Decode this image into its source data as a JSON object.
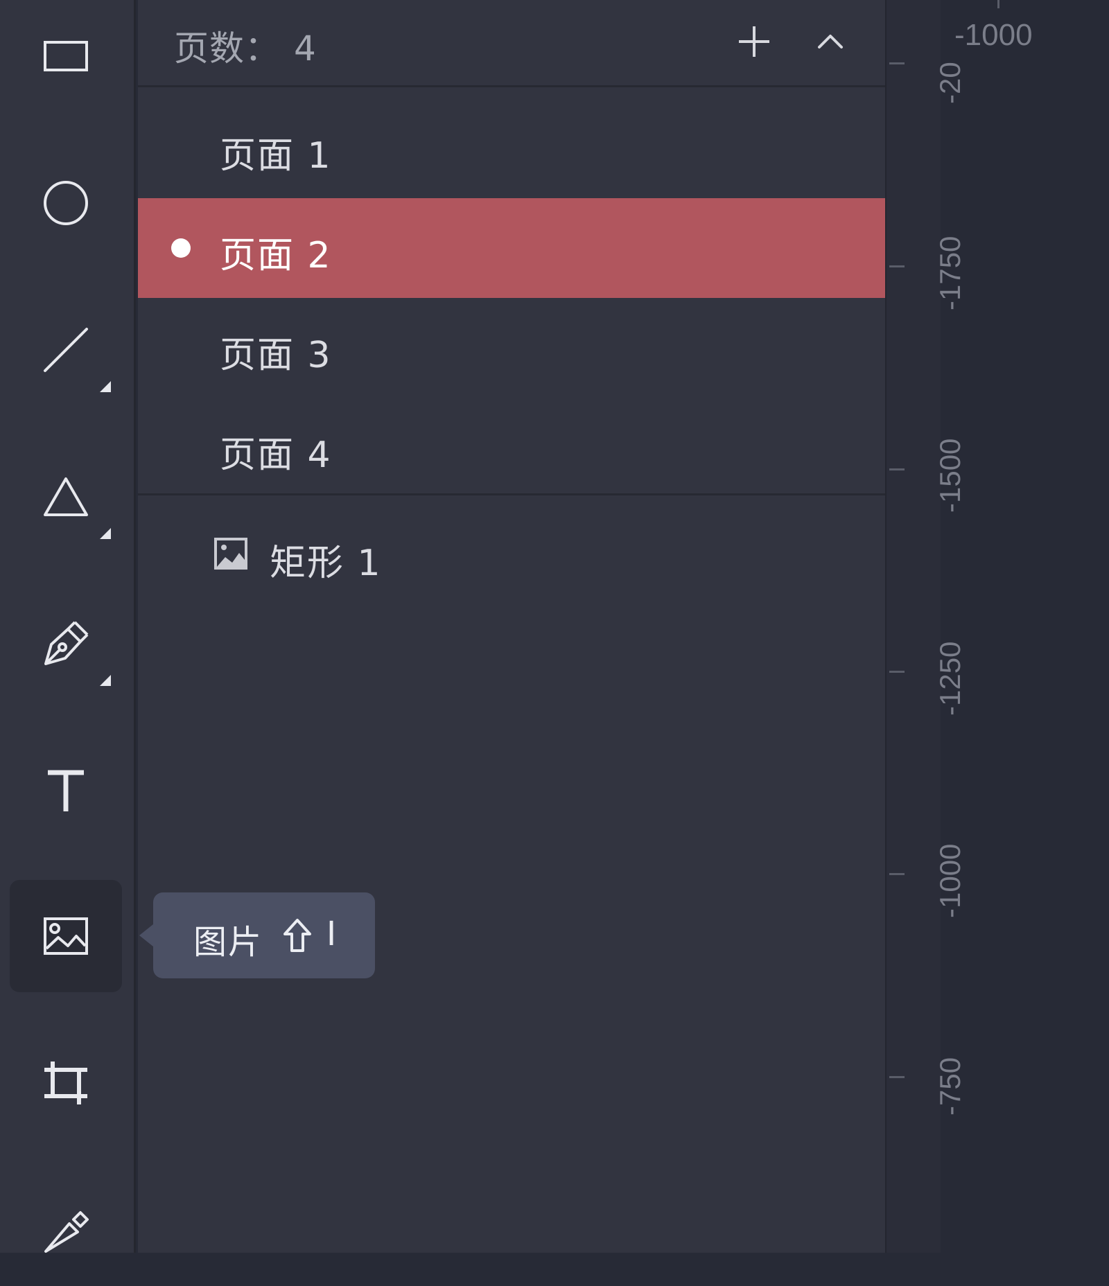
{
  "pages_panel": {
    "page_count_label": "页数：",
    "page_count_value": "4",
    "pages": [
      {
        "label": "页面 1",
        "selected": false
      },
      {
        "label": "页面 2",
        "selected": true
      },
      {
        "label": "页面 3",
        "selected": false
      },
      {
        "label": "页面 4",
        "selected": false
      }
    ],
    "layers": [
      {
        "label": "矩形 1",
        "icon": "image-icon"
      }
    ]
  },
  "toolbar": {
    "tools": [
      {
        "name": "rectangle-tool",
        "icon": "rectangle-icon"
      },
      {
        "name": "ellipse-tool",
        "icon": "circle-icon"
      },
      {
        "name": "line-tool",
        "icon": "line-icon"
      },
      {
        "name": "polygon-tool",
        "icon": "triangle-icon"
      },
      {
        "name": "pen-tool",
        "icon": "pen-nib-icon"
      },
      {
        "name": "text-tool",
        "icon": "text-icon"
      },
      {
        "name": "image-tool",
        "icon": "image-icon",
        "active": true
      },
      {
        "name": "crop-tool",
        "icon": "crop-icon"
      },
      {
        "name": "knife-tool",
        "icon": "knife-icon"
      }
    ]
  },
  "tooltip": {
    "label": "图片",
    "shortcut_modifier": "shift-arrow-icon",
    "shortcut_key": "I"
  },
  "ruler": {
    "top_label": "-1000",
    "labels": [
      "-20",
      "-1750",
      "-1500",
      "-1250",
      "-1000",
      "-750"
    ]
  },
  "colors": {
    "selected_page_bg": "#b1565e",
    "panel_bg": "#323440",
    "tooltip_bg": "#4b5064"
  }
}
